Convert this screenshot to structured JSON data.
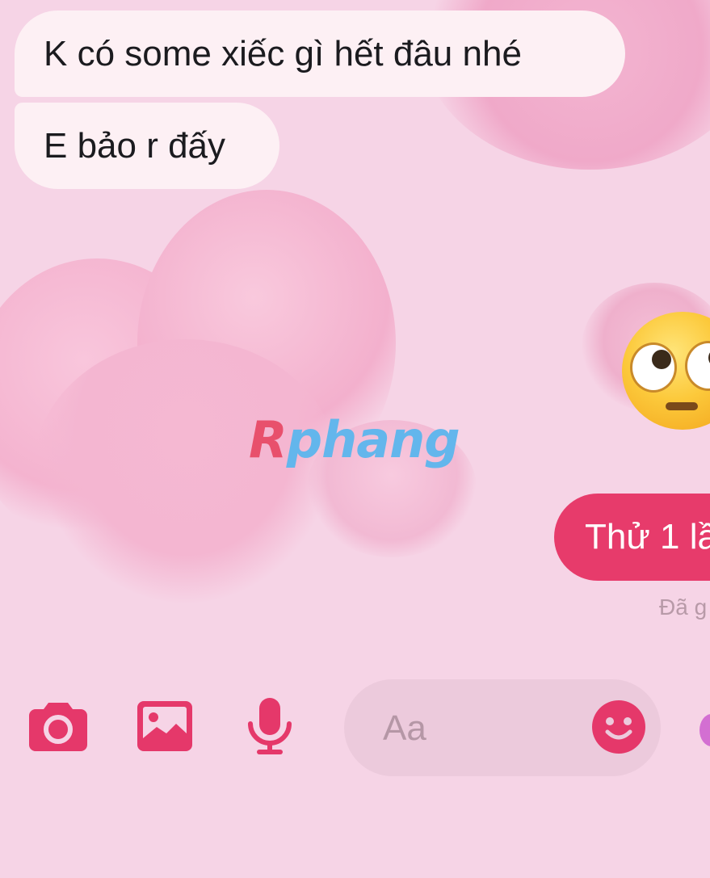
{
  "colors": {
    "background": "#f6d4e6",
    "incoming_bubble": "#fdf0f4",
    "outgoing_bubble": "#e73b6b",
    "accent": "#e5386a",
    "input_bg": "#eccadc"
  },
  "messages": {
    "incoming": [
      {
        "text": "K có some xiếc gì hết đâu nhé"
      },
      {
        "text": "E bảo r đấy"
      }
    ],
    "emoji": {
      "name": "face-with-rolling-eyes-emoji"
    },
    "outgoing": [
      {
        "text": "Thử 1 lầ"
      }
    ],
    "status": "Đã g"
  },
  "watermark": {
    "first": "R",
    "rest": "phang"
  },
  "composer": {
    "icons": [
      "camera-icon",
      "image-icon",
      "microphone-icon",
      "emoji-icon"
    ],
    "placeholder": "Aa"
  }
}
